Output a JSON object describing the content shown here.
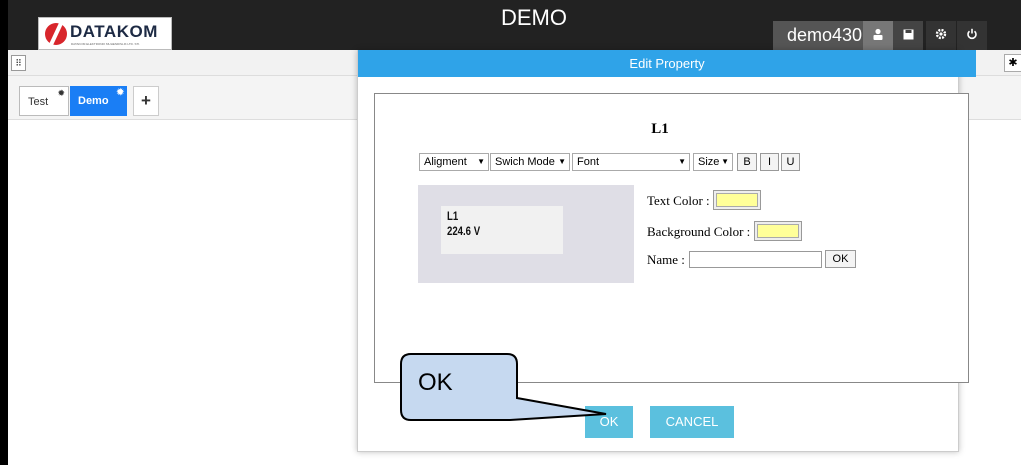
{
  "header": {
    "logo_text": "DATAKOM",
    "logo_subtext": "DATAKOM ELEKTRONIK MUHENDISLIK LTD. STI.",
    "title": "DEMO",
    "username": "demo430",
    "icons": [
      "user-icon",
      "save-icon",
      "gear-icon",
      "power-icon"
    ]
  },
  "tabs": [
    {
      "label": "Test"
    },
    {
      "label": "Demo"
    }
  ],
  "tab_add_label": "+",
  "dialog": {
    "title": "Edit Property",
    "property_title": "L1",
    "toolbar": {
      "alignment": "Aligment",
      "switch_mode": "Swich Mode",
      "font": "Font",
      "size": "Size",
      "bold": "B",
      "italic": "I",
      "underline": "U"
    },
    "preview": {
      "name": "L1",
      "value": "224.6 V"
    },
    "labels": {
      "text_color": "Text Color :",
      "background_color": "Background Color :",
      "name": "Name :",
      "name_ok": "OK"
    },
    "colors": {
      "text_color": "#ffff99",
      "background_color": "#ffff99"
    },
    "name_value": "",
    "footer": {
      "ok": "OK",
      "cancel": "CANCEL"
    }
  },
  "callout": {
    "text": "OK"
  },
  "colors": {
    "accent": "#2fa3e8",
    "tab_active": "#1a7ef5",
    "button": "#5bc0de",
    "header_bg": "#222222"
  }
}
